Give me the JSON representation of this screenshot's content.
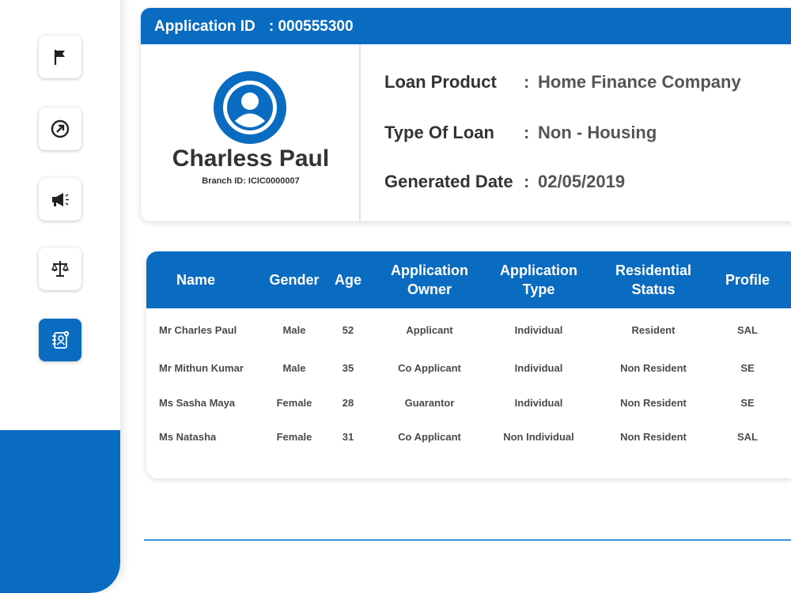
{
  "header": {
    "application_label": "Application ID",
    "application_id": ": 000555300"
  },
  "profile": {
    "name": "Charless Paul",
    "branch": "Branch ID: ICIC0000007"
  },
  "details": {
    "loan_product_label": "Loan Product",
    "loan_product_value": "Home Finance Company",
    "loan_type_label": "Type Of Loan",
    "loan_type_value": "Non - Housing",
    "generated_date_label": "Generated Date",
    "generated_date_value": "02/05/2019"
  },
  "table": {
    "headers": [
      "Name",
      "Gender",
      "Age",
      "Application Owner",
      "Application Type",
      "Residential Status",
      "Profile"
    ],
    "rows": [
      [
        "Mr Charles Paul",
        "Male",
        "52",
        "Applicant",
        "Individual",
        "Resident",
        "SAL"
      ],
      [
        "Mr Mithun Kumar",
        "Male",
        "35",
        "Co Applicant",
        "Individual",
        "Non Resident",
        "SE"
      ],
      [
        "Ms Sasha Maya",
        "Female",
        "28",
        "Guarantor",
        "Individual",
        "Non Resident",
        "SE"
      ],
      [
        "Ms Natasha",
        "Female",
        "31",
        "Co Applicant",
        "Non Individual",
        "Non Resident",
        "SAL"
      ]
    ]
  },
  "sidebar": {
    "icons": [
      "flag-icon",
      "arrow-circle-icon",
      "megaphone-icon",
      "scale-icon",
      "contact-book-icon"
    ],
    "active": "contact-book-icon"
  },
  "colors": {
    "primary": "#0a6cc0",
    "divider": "#3d8fd8"
  }
}
